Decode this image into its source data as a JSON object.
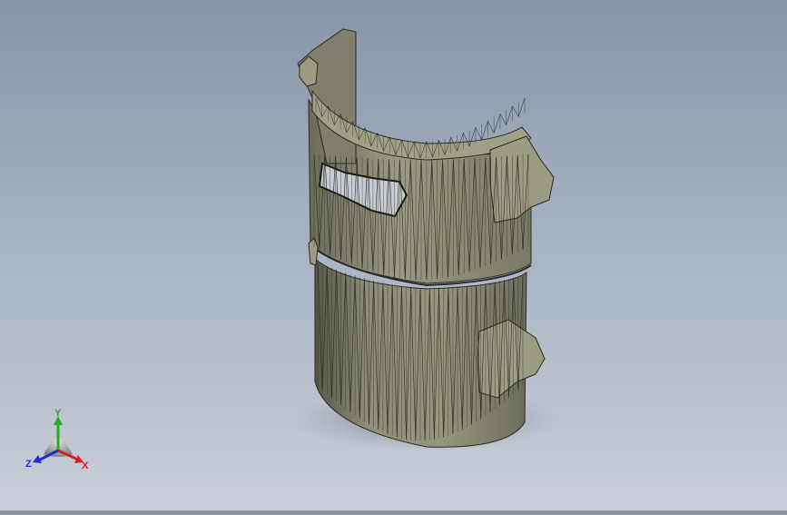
{
  "viewport": {
    "model_name": "",
    "background_top": "#8795a8",
    "background_bottom": "#c9ced8",
    "model_color": "#8a8a75",
    "mesh_color": "#2a2a22"
  },
  "triad": {
    "x_label": "X",
    "y_label": "Y",
    "z_label": "Z",
    "x_color": "#d62020",
    "y_color": "#20b020",
    "z_color": "#2030d0"
  }
}
